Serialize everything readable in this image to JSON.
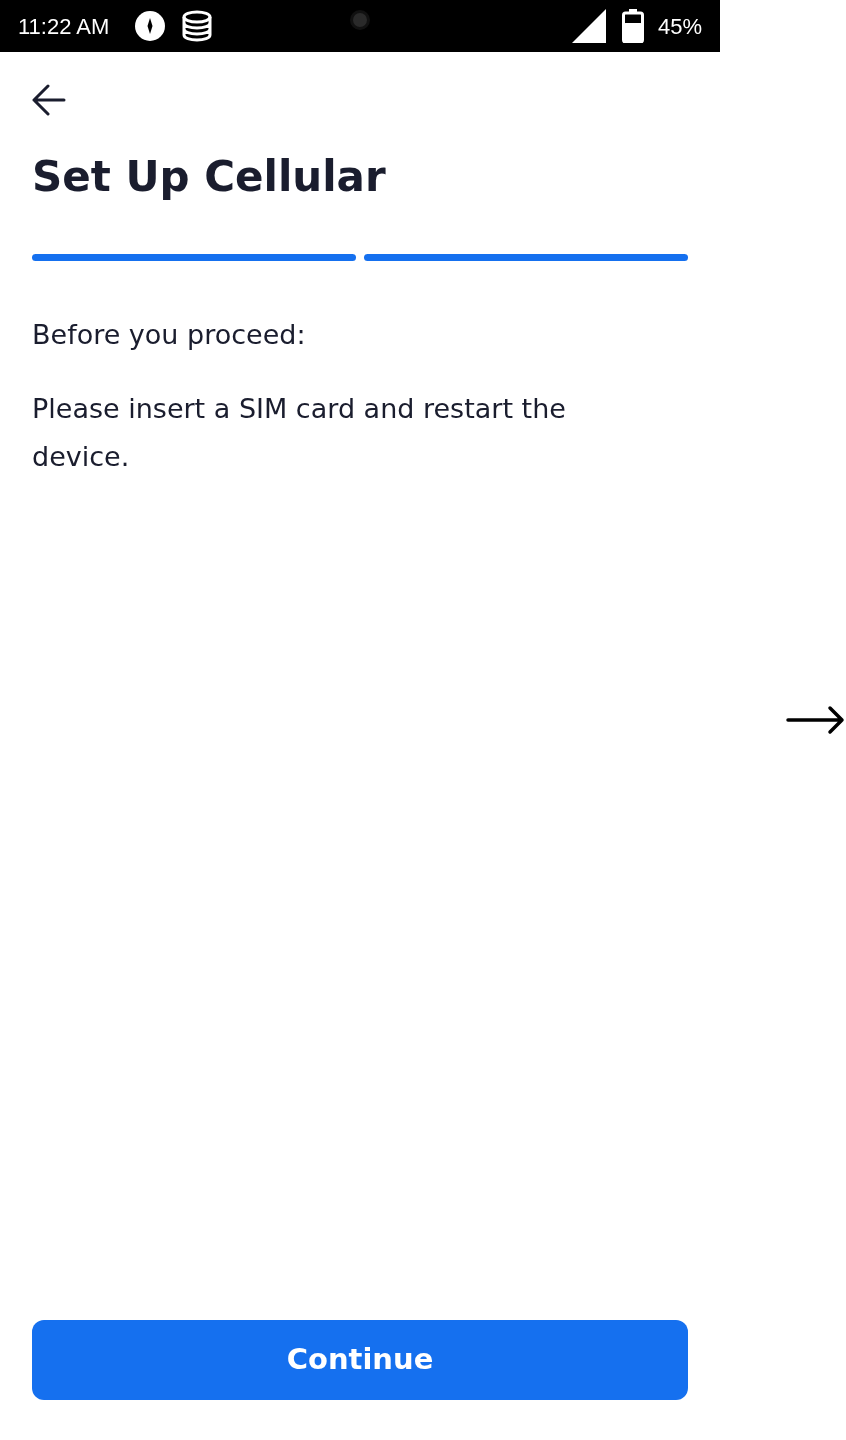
{
  "status_bar": {
    "time": "11:22 AM",
    "battery": "45%"
  },
  "title": "Set Up Cellular",
  "progress_steps": [
    {
      "done": true
    },
    {
      "done": true
    }
  ],
  "paragraphs": [
    "Before you proceed:",
    "Please insert a SIM card and restart the device."
  ],
  "continue_button": {
    "label": "Continue"
  }
}
